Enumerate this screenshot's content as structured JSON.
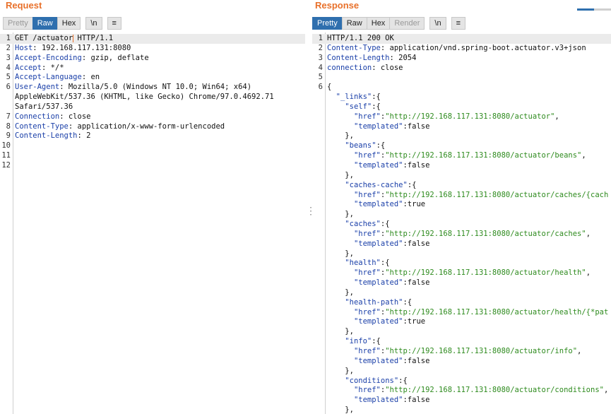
{
  "request": {
    "title": "Request",
    "tabs": {
      "pretty": "Pretty",
      "raw": "Raw",
      "hex": "Hex",
      "newline": "\\n",
      "menu": "≡"
    },
    "lines": [
      {
        "n": "1",
        "parts": [
          [
            "t",
            "GET /actuator"
          ],
          [
            "cursor",
            ""
          ],
          [
            "t",
            " HTTP/1.1"
          ]
        ]
      },
      {
        "n": "2",
        "parts": [
          [
            "k",
            "Host"
          ],
          [
            "t",
            ": 192.168.117.131:8080"
          ]
        ]
      },
      {
        "n": "3",
        "parts": [
          [
            "k",
            "Accept-Encoding"
          ],
          [
            "t",
            ": gzip, deflate"
          ]
        ]
      },
      {
        "n": "4",
        "parts": [
          [
            "k",
            "Accept"
          ],
          [
            "t",
            ": */*"
          ]
        ]
      },
      {
        "n": "5",
        "parts": [
          [
            "k",
            "Accept-Language"
          ],
          [
            "t",
            ": en"
          ]
        ]
      },
      {
        "n": "6",
        "parts": [
          [
            "k",
            "User-Agent"
          ],
          [
            "t",
            ": Mozilla/5.0 (Windows NT 10.0; Win64; x64)"
          ]
        ]
      },
      {
        "n": "",
        "parts": [
          [
            "t",
            "AppleWebKit/537.36 (KHTML, like Gecko) Chrome/97.0.4692.71"
          ]
        ]
      },
      {
        "n": "",
        "parts": [
          [
            "t",
            "Safari/537.36"
          ]
        ]
      },
      {
        "n": "7",
        "parts": [
          [
            "k",
            "Connection"
          ],
          [
            "t",
            ": close"
          ]
        ]
      },
      {
        "n": "8",
        "parts": [
          [
            "k",
            "Content-Type"
          ],
          [
            "t",
            ": application/x-www-form-urlencoded"
          ]
        ]
      },
      {
        "n": "9",
        "parts": [
          [
            "k",
            "Content-Length"
          ],
          [
            "t",
            ": 2"
          ]
        ]
      },
      {
        "n": "10",
        "parts": []
      },
      {
        "n": "11",
        "parts": []
      },
      {
        "n": "12",
        "parts": []
      }
    ]
  },
  "response": {
    "title": "Response",
    "tabs": {
      "pretty": "Pretty",
      "raw": "Raw",
      "hex": "Hex",
      "render": "Render",
      "newline": "\\n",
      "menu": "≡"
    },
    "lines": [
      {
        "n": "1",
        "parts": [
          [
            "t",
            "HTTP/1.1 200 OK"
          ]
        ]
      },
      {
        "n": "2",
        "parts": [
          [
            "k",
            "Content-Type"
          ],
          [
            "t",
            ": application/vnd.spring-boot.actuator.v3+json"
          ]
        ]
      },
      {
        "n": "3",
        "parts": [
          [
            "k",
            "Content-Length"
          ],
          [
            "t",
            ": 2054"
          ]
        ]
      },
      {
        "n": "4",
        "parts": [
          [
            "k",
            "connection"
          ],
          [
            "t",
            ": close"
          ]
        ]
      },
      {
        "n": "5",
        "parts": []
      },
      {
        "n": "6",
        "parts": [
          [
            "t",
            "{"
          ]
        ]
      },
      {
        "n": "",
        "parts": [
          [
            "t",
            "  "
          ],
          [
            "k",
            "\"_links\""
          ],
          [
            "t",
            ":{"
          ]
        ]
      },
      {
        "n": "",
        "parts": [
          [
            "t",
            "    "
          ],
          [
            "k",
            "\"self\""
          ],
          [
            "t",
            ":{"
          ]
        ]
      },
      {
        "n": "",
        "parts": [
          [
            "t",
            "      "
          ],
          [
            "k",
            "\"href\""
          ],
          [
            "t",
            ":"
          ],
          [
            "s",
            "\"http://192.168.117.131:8080/actuator\""
          ],
          [
            "t",
            ","
          ]
        ]
      },
      {
        "n": "",
        "parts": [
          [
            "t",
            "      "
          ],
          [
            "k",
            "\"templated\""
          ],
          [
            "t",
            ":false"
          ]
        ]
      },
      {
        "n": "",
        "parts": [
          [
            "t",
            "    },"
          ]
        ]
      },
      {
        "n": "",
        "parts": [
          [
            "t",
            "    "
          ],
          [
            "k",
            "\"beans\""
          ],
          [
            "t",
            ":{"
          ]
        ]
      },
      {
        "n": "",
        "parts": [
          [
            "t",
            "      "
          ],
          [
            "k",
            "\"href\""
          ],
          [
            "t",
            ":"
          ],
          [
            "s",
            "\"http://192.168.117.131:8080/actuator/beans\""
          ],
          [
            "t",
            ","
          ]
        ]
      },
      {
        "n": "",
        "parts": [
          [
            "t",
            "      "
          ],
          [
            "k",
            "\"templated\""
          ],
          [
            "t",
            ":false"
          ]
        ]
      },
      {
        "n": "",
        "parts": [
          [
            "t",
            "    },"
          ]
        ]
      },
      {
        "n": "",
        "parts": [
          [
            "t",
            "    "
          ],
          [
            "k",
            "\"caches-cache\""
          ],
          [
            "t",
            ":{"
          ]
        ]
      },
      {
        "n": "",
        "parts": [
          [
            "t",
            "      "
          ],
          [
            "k",
            "\"href\""
          ],
          [
            "t",
            ":"
          ],
          [
            "s",
            "\"http://192.168.117.131:8080/actuator/caches/{cach"
          ]
        ]
      },
      {
        "n": "",
        "parts": [
          [
            "t",
            "      "
          ],
          [
            "k",
            "\"templated\""
          ],
          [
            "t",
            ":true"
          ]
        ]
      },
      {
        "n": "",
        "parts": [
          [
            "t",
            "    },"
          ]
        ]
      },
      {
        "n": "",
        "parts": [
          [
            "t",
            "    "
          ],
          [
            "k",
            "\"caches\""
          ],
          [
            "t",
            ":{"
          ]
        ]
      },
      {
        "n": "",
        "parts": [
          [
            "t",
            "      "
          ],
          [
            "k",
            "\"href\""
          ],
          [
            "t",
            ":"
          ],
          [
            "s",
            "\"http://192.168.117.131:8080/actuator/caches\""
          ],
          [
            "t",
            ","
          ]
        ]
      },
      {
        "n": "",
        "parts": [
          [
            "t",
            "      "
          ],
          [
            "k",
            "\"templated\""
          ],
          [
            "t",
            ":false"
          ]
        ]
      },
      {
        "n": "",
        "parts": [
          [
            "t",
            "    },"
          ]
        ]
      },
      {
        "n": "",
        "parts": [
          [
            "t",
            "    "
          ],
          [
            "k",
            "\"health\""
          ],
          [
            "t",
            ":{"
          ]
        ]
      },
      {
        "n": "",
        "parts": [
          [
            "t",
            "      "
          ],
          [
            "k",
            "\"href\""
          ],
          [
            "t",
            ":"
          ],
          [
            "s",
            "\"http://192.168.117.131:8080/actuator/health\""
          ],
          [
            "t",
            ","
          ]
        ]
      },
      {
        "n": "",
        "parts": [
          [
            "t",
            "      "
          ],
          [
            "k",
            "\"templated\""
          ],
          [
            "t",
            ":false"
          ]
        ]
      },
      {
        "n": "",
        "parts": [
          [
            "t",
            "    },"
          ]
        ]
      },
      {
        "n": "",
        "parts": [
          [
            "t",
            "    "
          ],
          [
            "k",
            "\"health-path\""
          ],
          [
            "t",
            ":{"
          ]
        ]
      },
      {
        "n": "",
        "parts": [
          [
            "t",
            "      "
          ],
          [
            "k",
            "\"href\""
          ],
          [
            "t",
            ":"
          ],
          [
            "s",
            "\"http://192.168.117.131:8080/actuator/health/{*pat"
          ]
        ]
      },
      {
        "n": "",
        "parts": [
          [
            "t",
            "      "
          ],
          [
            "k",
            "\"templated\""
          ],
          [
            "t",
            ":true"
          ]
        ]
      },
      {
        "n": "",
        "parts": [
          [
            "t",
            "    },"
          ]
        ]
      },
      {
        "n": "",
        "parts": [
          [
            "t",
            "    "
          ],
          [
            "k",
            "\"info\""
          ],
          [
            "t",
            ":{"
          ]
        ]
      },
      {
        "n": "",
        "parts": [
          [
            "t",
            "      "
          ],
          [
            "k",
            "\"href\""
          ],
          [
            "t",
            ":"
          ],
          [
            "s",
            "\"http://192.168.117.131:8080/actuator/info\""
          ],
          [
            "t",
            ","
          ]
        ]
      },
      {
        "n": "",
        "parts": [
          [
            "t",
            "      "
          ],
          [
            "k",
            "\"templated\""
          ],
          [
            "t",
            ":false"
          ]
        ]
      },
      {
        "n": "",
        "parts": [
          [
            "t",
            "    },"
          ]
        ]
      },
      {
        "n": "",
        "parts": [
          [
            "t",
            "    "
          ],
          [
            "k",
            "\"conditions\""
          ],
          [
            "t",
            ":{"
          ]
        ]
      },
      {
        "n": "",
        "parts": [
          [
            "t",
            "      "
          ],
          [
            "k",
            "\"href\""
          ],
          [
            "t",
            ":"
          ],
          [
            "s",
            "\"http://192.168.117.131:8080/actuator/conditions\""
          ],
          [
            "t",
            ","
          ]
        ]
      },
      {
        "n": "",
        "parts": [
          [
            "t",
            "      "
          ],
          [
            "k",
            "\"templated\""
          ],
          [
            "t",
            ":false"
          ]
        ]
      },
      {
        "n": "",
        "parts": [
          [
            "t",
            "    },"
          ]
        ]
      }
    ]
  },
  "colors": {
    "title": "#e8702a",
    "active_tab": "#2f6fae",
    "key": "#1a3fa8",
    "string": "#2e8b1e"
  },
  "divider_glyph": "⋮"
}
